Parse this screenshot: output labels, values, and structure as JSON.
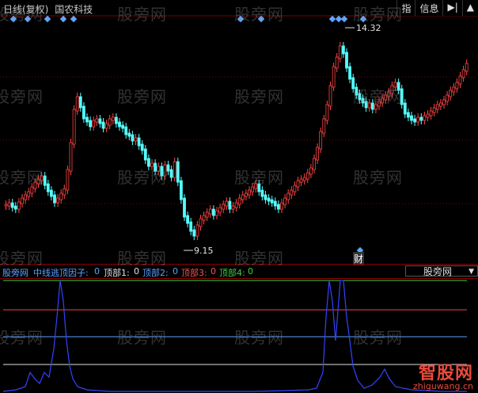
{
  "header": {
    "period": "日线(复权)",
    "stock_name": "国农科技"
  },
  "toolbar": {
    "indicator_label": "指",
    "info_label": "信息",
    "nav_icon": "skip-arrow-icon",
    "expand_icon": "up-triangle-icon"
  },
  "price_labels": {
    "high": "14.32",
    "low": "9.15"
  },
  "signal_marker": "财",
  "indicator_bar": {
    "site": "股旁网",
    "name": "中线逃顶因子:",
    "name_value": "0",
    "items": [
      {
        "label": "顶部1:",
        "value": "0",
        "color": "#e0e0e0"
      },
      {
        "label": "顶部2:",
        "value": "0",
        "color": "#5aa0ff"
      },
      {
        "label": "顶部3:",
        "value": "0",
        "color": "#ff5050"
      },
      {
        "label": "顶部4:",
        "value": "0",
        "color": "#40d040"
      }
    ],
    "selector": "股旁网"
  },
  "watermark": "股旁网",
  "logo": {
    "text": "智股网",
    "url": "zhiguwang.cn"
  },
  "colors": {
    "up": "#ff4444",
    "down": "#54ffff",
    "grid": "#8b0000",
    "indicator_line": "#3344ff"
  }
}
